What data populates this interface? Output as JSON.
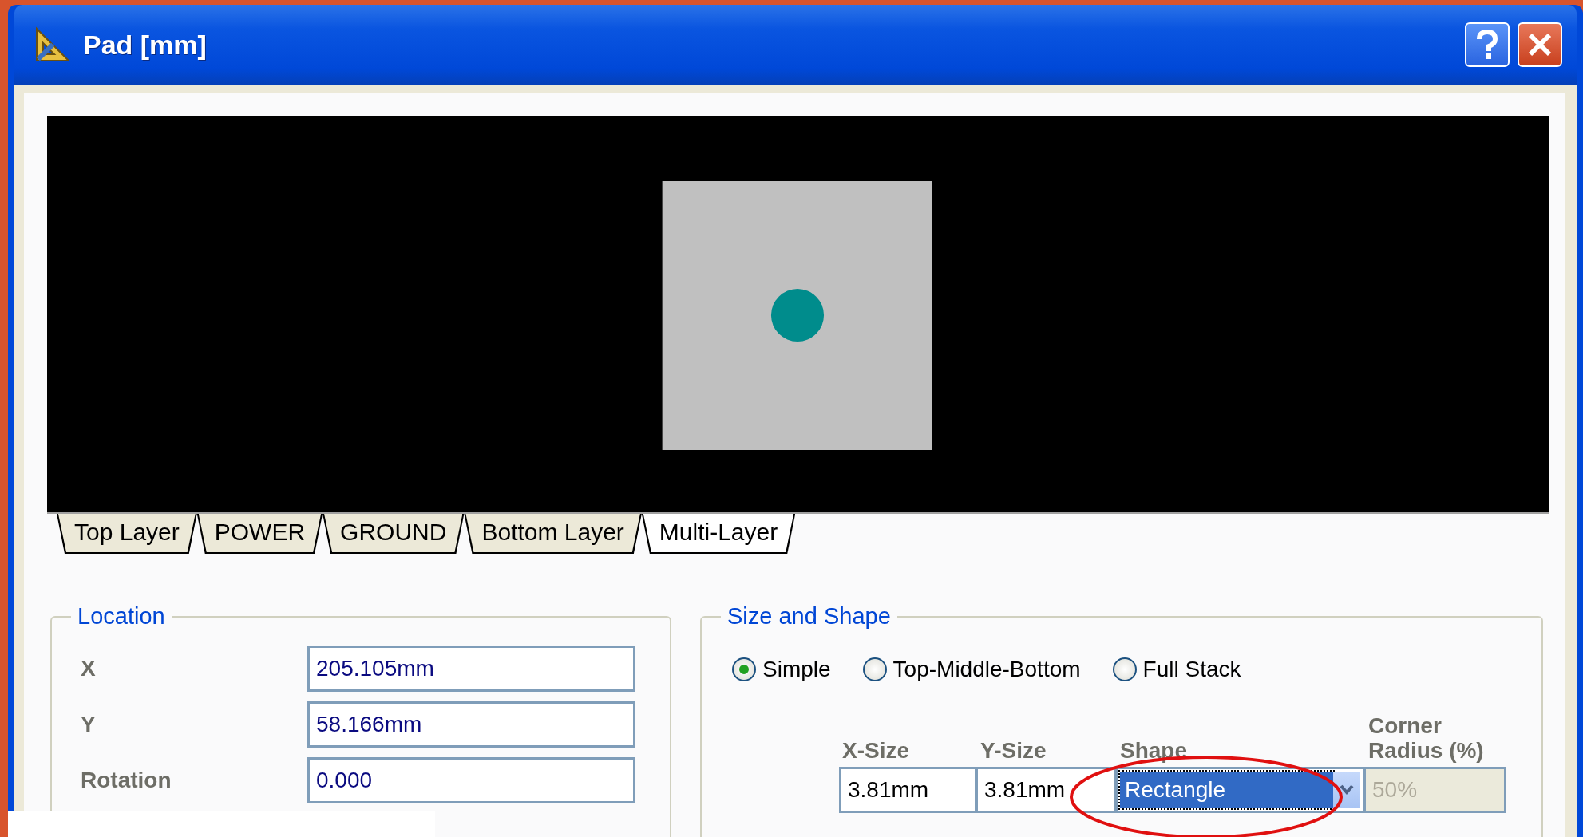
{
  "window": {
    "title": "Pad [mm]"
  },
  "layer_tabs": [
    {
      "label": "Top Layer",
      "selected": false
    },
    {
      "label": "POWER",
      "selected": false
    },
    {
      "label": "GROUND",
      "selected": false
    },
    {
      "label": "Bottom Layer",
      "selected": false
    },
    {
      "label": "Multi-Layer",
      "selected": true
    }
  ],
  "location": {
    "title": "Location",
    "fields": [
      {
        "label": "X",
        "value": "205.105mm"
      },
      {
        "label": "Y",
        "value": "58.166mm"
      },
      {
        "label": "Rotation",
        "value": "0.000"
      }
    ]
  },
  "size_and_shape": {
    "title": "Size and Shape",
    "modes": [
      {
        "label": "Simple",
        "selected": true
      },
      {
        "label": "Top-Middle-Bottom",
        "selected": false
      },
      {
        "label": "Full Stack",
        "selected": false
      }
    ],
    "columns": [
      "X-Size",
      "Y-Size",
      "Shape",
      "Corner Radius (%)"
    ],
    "x_size": "3.81mm",
    "y_size": "3.81mm",
    "shape": "Rectangle",
    "corner_radius": {
      "value": "50%",
      "disabled": true
    }
  }
}
